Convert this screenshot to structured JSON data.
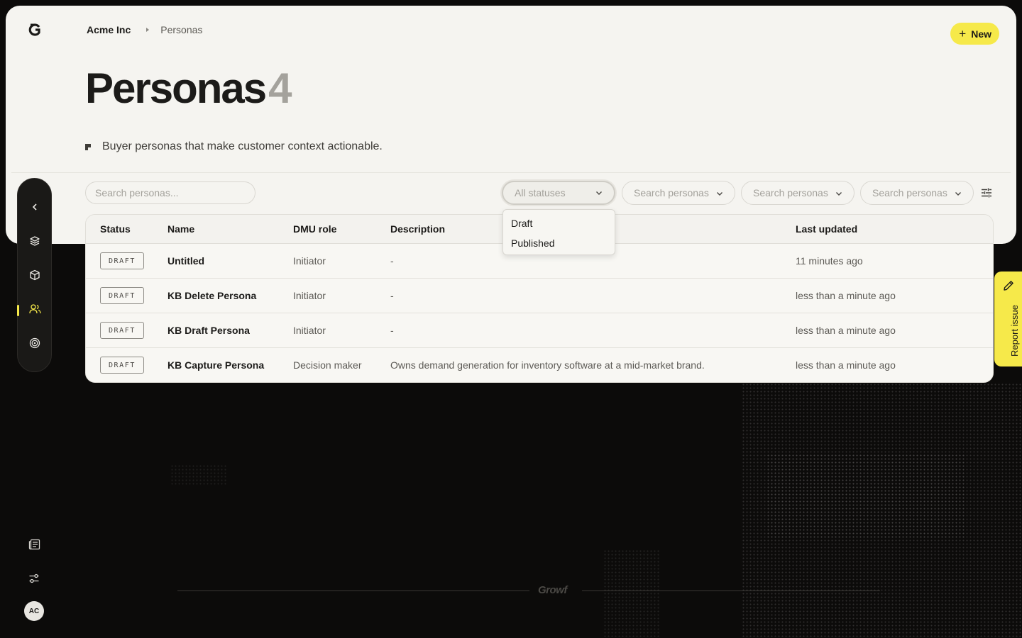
{
  "breadcrumb": {
    "org": "Acme Inc",
    "page": "Personas"
  },
  "header": {
    "new_label": "New",
    "title": "Personas",
    "count": "4",
    "subtitle": "Buyer personas that make customer context actionable."
  },
  "filters": {
    "search_placeholder": "Search personas...",
    "status_value": "All statuses",
    "filter2": "Search personas",
    "filter3": "Search personas",
    "filter4": "Search personas",
    "status_options": [
      "Draft",
      "Published"
    ]
  },
  "table": {
    "columns": [
      "Status",
      "Name",
      "DMU role",
      "Description",
      "Last updated"
    ],
    "rows": [
      {
        "status": "DRAFT",
        "name": "Untitled",
        "role": "Initiator",
        "description": "-",
        "updated": "11 minutes ago"
      },
      {
        "status": "DRAFT",
        "name": "KB Delete Persona",
        "role": "Initiator",
        "description": "-",
        "updated": "less than a minute ago"
      },
      {
        "status": "DRAFT",
        "name": "KB Draft Persona",
        "role": "Initiator",
        "description": "-",
        "updated": "less than a minute ago"
      },
      {
        "status": "DRAFT",
        "name": "KB Capture Persona",
        "role": "Decision maker",
        "description": "Owns demand generation for inventory software at a mid-market brand.",
        "updated": "less than a minute ago"
      }
    ]
  },
  "report_issue": "Report issue",
  "user": {
    "initials": "AC"
  },
  "footer": {
    "brand": "Growf"
  },
  "colors": {
    "accent": "#f6e94a",
    "panel": "#f5f4f0",
    "background": "#0c0b0a",
    "rail": "#1a1917"
  },
  "icons": {
    "logo": "growf-logo-icon",
    "rail": [
      "chevron-left-icon",
      "layers-icon",
      "cube-icon",
      "users-icon",
      "target-icon"
    ],
    "bottom": [
      "newspaper-icon",
      "sliders-icon"
    ],
    "settings": "adjustments-icon",
    "report": "pencil-icon"
  }
}
